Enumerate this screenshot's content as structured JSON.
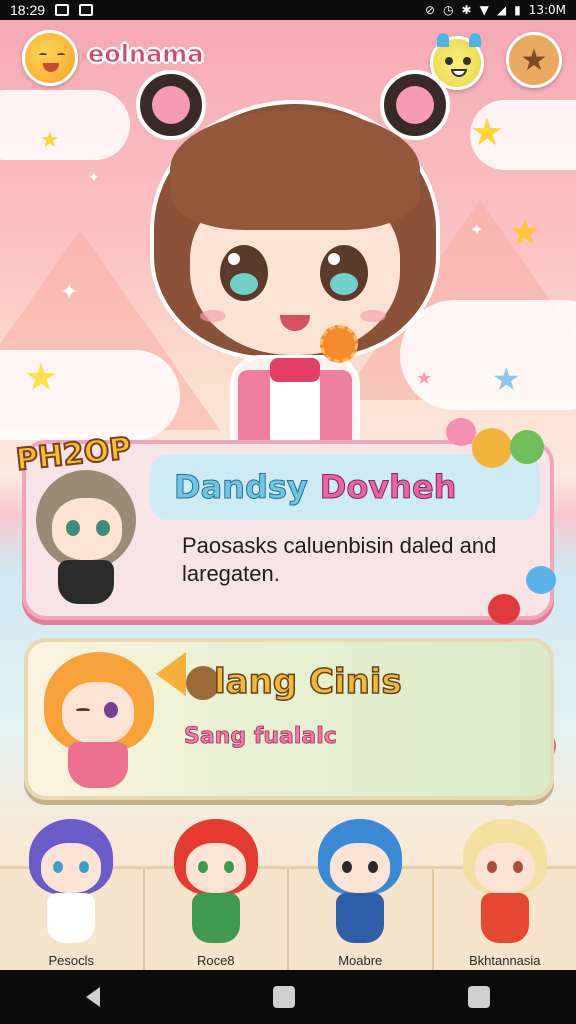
{
  "status_bar": {
    "time": "18:29",
    "right_time": "13:0M"
  },
  "header": {
    "username": "eolnama"
  },
  "panel_featured": {
    "badge": "PH2OP",
    "title_part1": "Dandsy",
    "title_part2": "Dovheh",
    "description": "Paosasks caluenbisin daled and laregaten."
  },
  "panel_event": {
    "title": "lang Cinis",
    "subtitle": "Sang fualalc"
  },
  "roster": [
    {
      "name": "Pesocls",
      "hair": "#6b5bc9",
      "eyes": "#3aa0c8",
      "outfit": "#ffffff"
    },
    {
      "name": "Roce8",
      "hair": "#e53a2e",
      "eyes": "#3a9a4a",
      "outfit": "#3e9a4c"
    },
    {
      "name": "Moabre",
      "hair": "#3a8ad6",
      "eyes": "#2a2a2a",
      "outfit": "#2f5fa8"
    },
    {
      "name": "Bkhtannasia",
      "hair": "#f4e1a0",
      "eyes": "#b04a3a",
      "outfit": "#e8472f"
    }
  ],
  "colors": {
    "accent_pink": "#e964a5",
    "accent_blue": "#6cc7e2",
    "accent_gold": "#f0b93a"
  }
}
